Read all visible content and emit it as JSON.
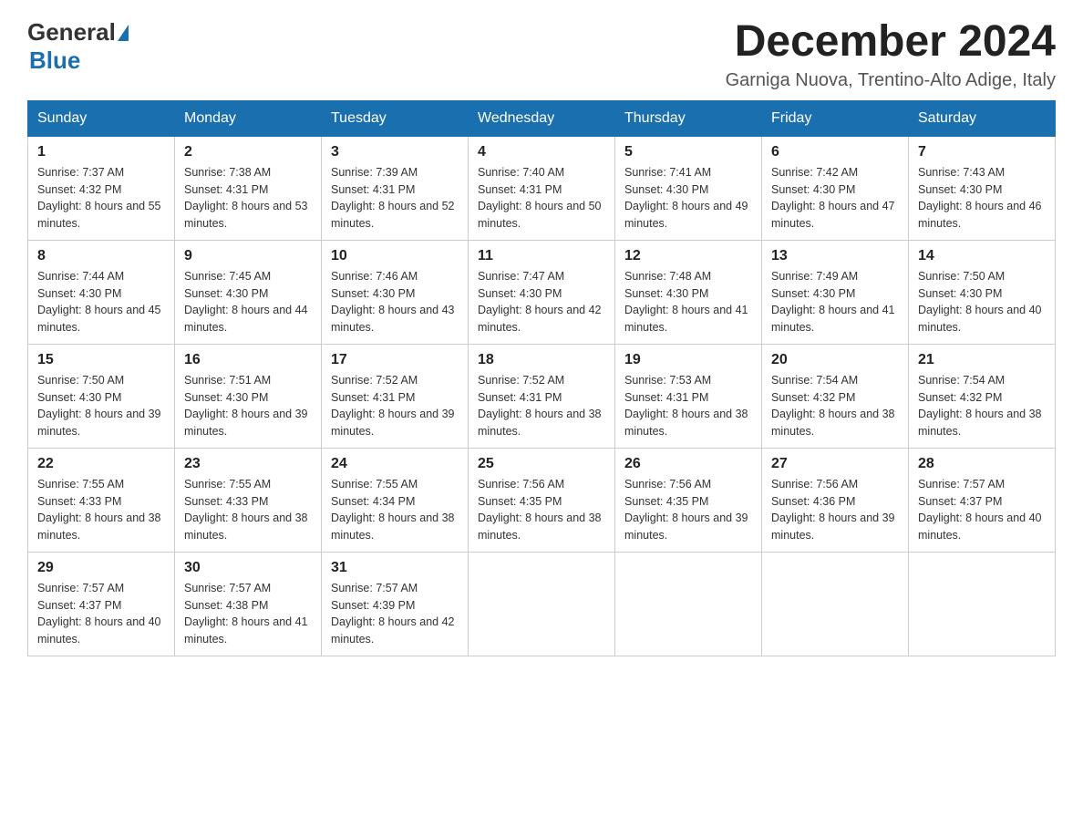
{
  "logo": {
    "general": "General",
    "blue": "Blue",
    "triangle": "▶"
  },
  "title": "December 2024",
  "subtitle": "Garniga Nuova, Trentino-Alto Adige, Italy",
  "days_of_week": [
    "Sunday",
    "Monday",
    "Tuesday",
    "Wednesday",
    "Thursday",
    "Friday",
    "Saturday"
  ],
  "weeks": [
    [
      {
        "day": "1",
        "sunrise": "7:37 AM",
        "sunset": "4:32 PM",
        "daylight": "8 hours and 55 minutes."
      },
      {
        "day": "2",
        "sunrise": "7:38 AM",
        "sunset": "4:31 PM",
        "daylight": "8 hours and 53 minutes."
      },
      {
        "day": "3",
        "sunrise": "7:39 AM",
        "sunset": "4:31 PM",
        "daylight": "8 hours and 52 minutes."
      },
      {
        "day": "4",
        "sunrise": "7:40 AM",
        "sunset": "4:31 PM",
        "daylight": "8 hours and 50 minutes."
      },
      {
        "day": "5",
        "sunrise": "7:41 AM",
        "sunset": "4:30 PM",
        "daylight": "8 hours and 49 minutes."
      },
      {
        "day": "6",
        "sunrise": "7:42 AM",
        "sunset": "4:30 PM",
        "daylight": "8 hours and 47 minutes."
      },
      {
        "day": "7",
        "sunrise": "7:43 AM",
        "sunset": "4:30 PM",
        "daylight": "8 hours and 46 minutes."
      }
    ],
    [
      {
        "day": "8",
        "sunrise": "7:44 AM",
        "sunset": "4:30 PM",
        "daylight": "8 hours and 45 minutes."
      },
      {
        "day": "9",
        "sunrise": "7:45 AM",
        "sunset": "4:30 PM",
        "daylight": "8 hours and 44 minutes."
      },
      {
        "day": "10",
        "sunrise": "7:46 AM",
        "sunset": "4:30 PM",
        "daylight": "8 hours and 43 minutes."
      },
      {
        "day": "11",
        "sunrise": "7:47 AM",
        "sunset": "4:30 PM",
        "daylight": "8 hours and 42 minutes."
      },
      {
        "day": "12",
        "sunrise": "7:48 AM",
        "sunset": "4:30 PM",
        "daylight": "8 hours and 41 minutes."
      },
      {
        "day": "13",
        "sunrise": "7:49 AM",
        "sunset": "4:30 PM",
        "daylight": "8 hours and 41 minutes."
      },
      {
        "day": "14",
        "sunrise": "7:50 AM",
        "sunset": "4:30 PM",
        "daylight": "8 hours and 40 minutes."
      }
    ],
    [
      {
        "day": "15",
        "sunrise": "7:50 AM",
        "sunset": "4:30 PM",
        "daylight": "8 hours and 39 minutes."
      },
      {
        "day": "16",
        "sunrise": "7:51 AM",
        "sunset": "4:30 PM",
        "daylight": "8 hours and 39 minutes."
      },
      {
        "day": "17",
        "sunrise": "7:52 AM",
        "sunset": "4:31 PM",
        "daylight": "8 hours and 39 minutes."
      },
      {
        "day": "18",
        "sunrise": "7:52 AM",
        "sunset": "4:31 PM",
        "daylight": "8 hours and 38 minutes."
      },
      {
        "day": "19",
        "sunrise": "7:53 AM",
        "sunset": "4:31 PM",
        "daylight": "8 hours and 38 minutes."
      },
      {
        "day": "20",
        "sunrise": "7:54 AM",
        "sunset": "4:32 PM",
        "daylight": "8 hours and 38 minutes."
      },
      {
        "day": "21",
        "sunrise": "7:54 AM",
        "sunset": "4:32 PM",
        "daylight": "8 hours and 38 minutes."
      }
    ],
    [
      {
        "day": "22",
        "sunrise": "7:55 AM",
        "sunset": "4:33 PM",
        "daylight": "8 hours and 38 minutes."
      },
      {
        "day": "23",
        "sunrise": "7:55 AM",
        "sunset": "4:33 PM",
        "daylight": "8 hours and 38 minutes."
      },
      {
        "day": "24",
        "sunrise": "7:55 AM",
        "sunset": "4:34 PM",
        "daylight": "8 hours and 38 minutes."
      },
      {
        "day": "25",
        "sunrise": "7:56 AM",
        "sunset": "4:35 PM",
        "daylight": "8 hours and 38 minutes."
      },
      {
        "day": "26",
        "sunrise": "7:56 AM",
        "sunset": "4:35 PM",
        "daylight": "8 hours and 39 minutes."
      },
      {
        "day": "27",
        "sunrise": "7:56 AM",
        "sunset": "4:36 PM",
        "daylight": "8 hours and 39 minutes."
      },
      {
        "day": "28",
        "sunrise": "7:57 AM",
        "sunset": "4:37 PM",
        "daylight": "8 hours and 40 minutes."
      }
    ],
    [
      {
        "day": "29",
        "sunrise": "7:57 AM",
        "sunset": "4:37 PM",
        "daylight": "8 hours and 40 minutes."
      },
      {
        "day": "30",
        "sunrise": "7:57 AM",
        "sunset": "4:38 PM",
        "daylight": "8 hours and 41 minutes."
      },
      {
        "day": "31",
        "sunrise": "7:57 AM",
        "sunset": "4:39 PM",
        "daylight": "8 hours and 42 minutes."
      },
      null,
      null,
      null,
      null
    ]
  ],
  "labels": {
    "sunrise": "Sunrise:",
    "sunset": "Sunset:",
    "daylight": "Daylight:"
  }
}
